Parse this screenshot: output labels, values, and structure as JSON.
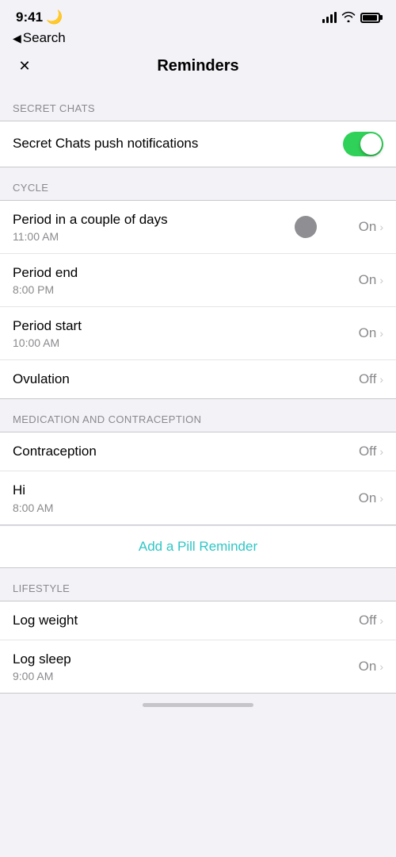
{
  "statusBar": {
    "time": "9:41",
    "moonIcon": "🌙"
  },
  "backNav": {
    "chevron": "◀",
    "label": "Search"
  },
  "header": {
    "closeIcon": "✕",
    "title": "Reminders"
  },
  "sections": {
    "secretChats": {
      "label": "SECRET CHATS",
      "rows": [
        {
          "title": "Secret Chats push notifications",
          "toggleOn": true
        }
      ]
    },
    "cycle": {
      "label": "CYCLE",
      "rows": [
        {
          "title": "Period in a couple of days",
          "subtitle": "11:00 AM",
          "value": "On",
          "hasChevron": true,
          "hasDot": true
        },
        {
          "title": "Period end",
          "subtitle": "8:00 PM",
          "value": "On",
          "hasChevron": true
        },
        {
          "title": "Period start",
          "subtitle": "10:00 AM",
          "value": "On",
          "hasChevron": true
        },
        {
          "title": "Ovulation",
          "subtitle": "",
          "value": "Off",
          "hasChevron": true
        }
      ]
    },
    "medicationAndContraception": {
      "label": "MEDICATION AND CONTRACEPTION",
      "rows": [
        {
          "title": "Contraception",
          "subtitle": "",
          "value": "Off",
          "hasChevron": true
        },
        {
          "title": "Hi",
          "subtitle": "8:00 AM",
          "value": "On",
          "hasChevron": true
        }
      ],
      "addPillLabel": "Add a Pill Reminder"
    },
    "lifestyle": {
      "label": "LIFESTYLE",
      "rows": [
        {
          "title": "Log weight",
          "subtitle": "",
          "value": "Off",
          "hasChevron": true
        },
        {
          "title": "Log sleep",
          "subtitle": "9:00 AM",
          "value": "On",
          "hasChevron": true
        }
      ]
    }
  }
}
